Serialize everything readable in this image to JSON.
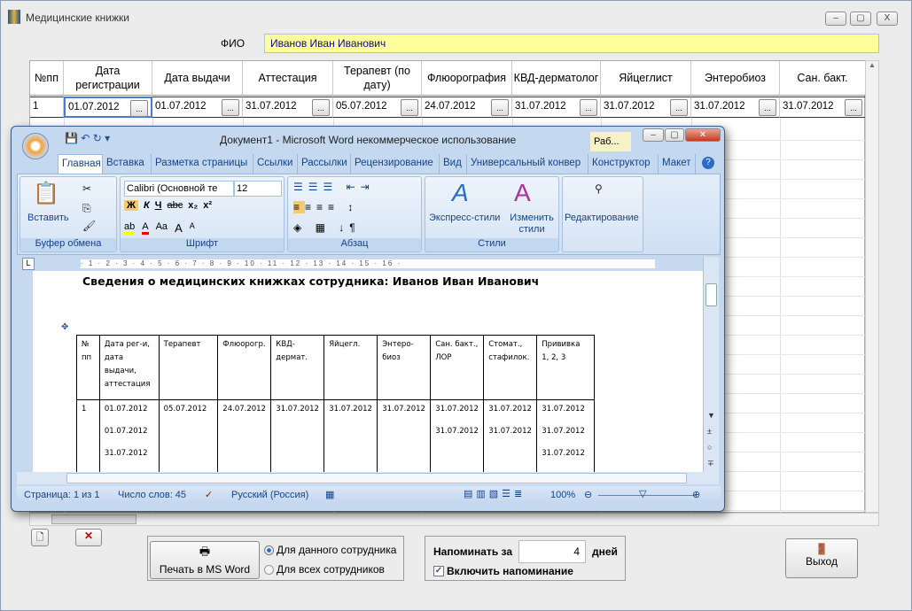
{
  "window": {
    "title": "Медицинские книжки",
    "min": "–",
    "max": "▢",
    "close": "X"
  },
  "fio": {
    "label": "ФИО",
    "value": "Иванов Иван Иванович"
  },
  "grid": {
    "columns": [
      "№пп",
      "Дата регистрации",
      "Дата выдачи",
      "Аттестация",
      "Терапевт (по дату)",
      "Флюорография",
      "КВД-дерматолог",
      "Яйцеглист",
      "Энтеробиоз",
      "Сан. бакт."
    ],
    "row": [
      "1",
      "01.07.2012",
      "01.07.2012",
      "31.07.2012",
      "05.07.2012",
      "24.07.2012",
      "31.07.2012",
      "31.07.2012",
      "31.07.2012",
      "31.07.2012"
    ],
    "dots": "..."
  },
  "word": {
    "title": "Документ1 - Microsoft Word некоммерческое использование",
    "context_tab": "Раб...",
    "tabs": [
      "Главная",
      "Вставка",
      "Разметка страницы",
      "Ссылки",
      "Рассылки",
      "Рецензирование",
      "Вид",
      "Универсальный конвер",
      "Конструктор",
      "Макет"
    ],
    "ribbon": {
      "paste": "Вставить",
      "clipboard": "Буфер обмена",
      "font_name": "Calibri (Основной те",
      "font_size": "12",
      "font": "Шрифт",
      "paragraph": "Абзац",
      "quick_styles": "Экспресс-стили",
      "change_styles": "Изменить стили",
      "styles": "Стили",
      "editing": "Редактирование",
      "bold": "Ж",
      "italic": "К",
      "underline": "Ч",
      "strike": "abc",
      "sub": "x₂",
      "sup": "x²",
      "aa": "Aa",
      "grow": "A",
      "shrink": "A",
      "pilcrow": "¶"
    },
    "doc": {
      "heading": "Сведения о медицинских книжках сотрудника: Иванов Иван Иванович",
      "headers": [
        "№ пп",
        "Дата рег-и, дата выдачи, аттестация",
        "Терапевт",
        "Флюорогр.",
        "КВД-дермат.",
        "Яйцегл.",
        "Энтеро-биоз",
        "Сан. бакт., ЛОР",
        "Стомат., стафилок.",
        "Прививка 1, 2, 3"
      ],
      "cells": [
        [
          "1"
        ],
        [
          "01.07.2012",
          "01.07.2012",
          "31.07.2012"
        ],
        [
          "05.07.2012"
        ],
        [
          "24.07.2012"
        ],
        [
          "31.07.2012"
        ],
        [
          "31.07.2012"
        ],
        [
          "31.07.2012"
        ],
        [
          "31.07.2012",
          "31.07.2012"
        ],
        [
          "31.07.2012",
          "31.07.2012"
        ],
        [
          "31.07.2012",
          "31.07.2012",
          "31.07.2012"
        ]
      ]
    },
    "status": {
      "page": "Страница: 1 из 1",
      "words": "Число слов: 45",
      "lang": "Русский (Россия)",
      "zoom": "100%"
    }
  },
  "print": {
    "button": "Печать в MS Word",
    "opt1": "Для данного сотрудника",
    "opt2": "Для всех сотрудников",
    "selected": "opt1"
  },
  "remind": {
    "label": "Напоминать за",
    "value": "4",
    "unit": "дней",
    "checkbox": "Включить напоминание",
    "checked": true
  },
  "exit": {
    "label": "Выход"
  }
}
